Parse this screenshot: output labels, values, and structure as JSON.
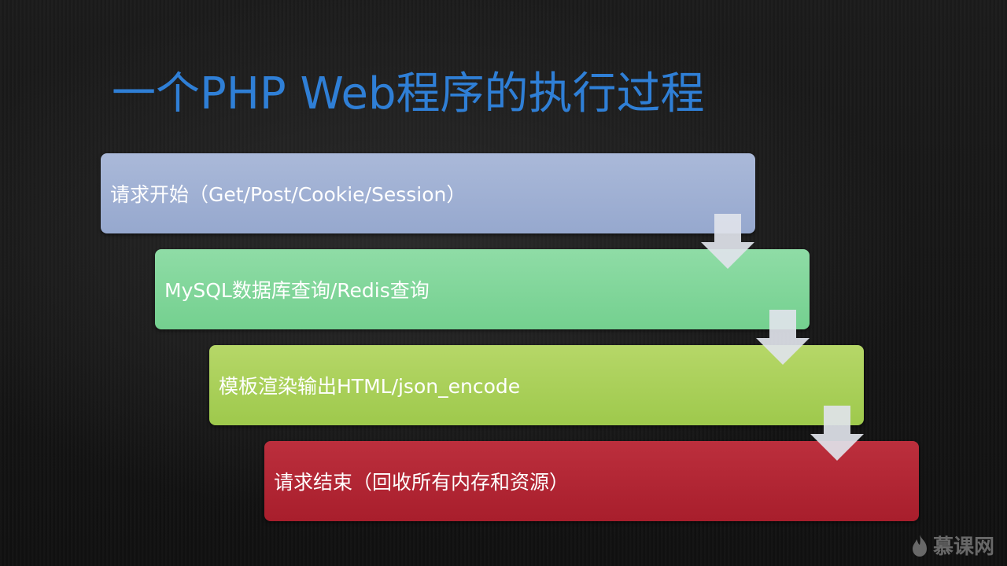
{
  "title": "一个PHP Web程序的执行过程",
  "steps": [
    {
      "label": "请求开始（Get/Post/Cookie/Session）",
      "color": "#a0b0d4"
    },
    {
      "label": "MySQL数据库查询/Redis查询",
      "color": "#7fd59a"
    },
    {
      "label": "模板渲染输出HTML/json_encode",
      "color": "#a9cf5a"
    },
    {
      "label": "请求结束（回收所有内存和资源）",
      "color": "#b02633"
    }
  ],
  "arrow_color": "#dfe3ea",
  "watermark": {
    "text": "慕课网",
    "icon": "flame-icon"
  }
}
